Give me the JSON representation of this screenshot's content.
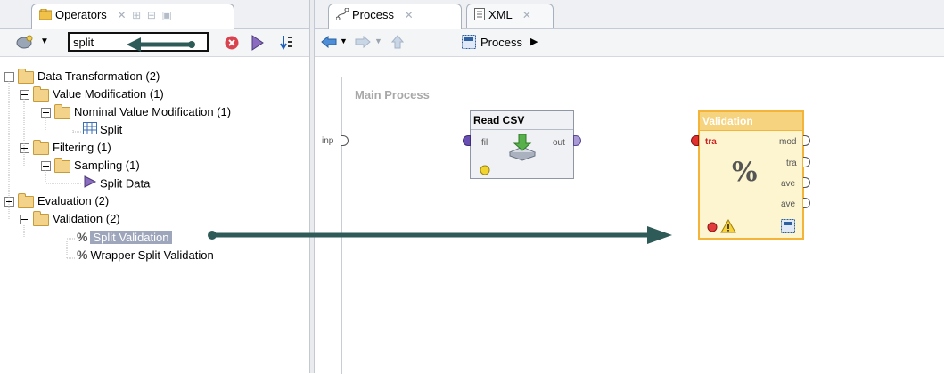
{
  "left_panel": {
    "tab_label": "Operators",
    "search_value": "split",
    "tree": [
      {
        "label": "Data Transformation (2)"
      },
      {
        "label": "Value Modification (1)"
      },
      {
        "label": "Nominal Value Modification (1)"
      },
      {
        "label": "Split"
      },
      {
        "label": "Filtering (1)"
      },
      {
        "label": "Sampling (1)"
      },
      {
        "label": "Split Data"
      },
      {
        "label": "Evaluation (2)"
      },
      {
        "label": "Validation (2)"
      },
      {
        "label": "Split Validation"
      },
      {
        "label": "Wrapper Split Validation"
      }
    ]
  },
  "right_panel": {
    "tabs": [
      {
        "label": "Process"
      },
      {
        "label": "XML"
      }
    ],
    "breadcrumb": "Process",
    "canvas_title": "Main Process",
    "input_port": "inp",
    "read_csv": {
      "title": "Read CSV",
      "in_port": "fil",
      "out_port": "out"
    },
    "validation": {
      "title": "Validation",
      "in_port": "tra",
      "out_ports": [
        "mod",
        "tra",
        "ave",
        "ave"
      ]
    }
  },
  "colors": {
    "accent_arrow": "#2e5a57",
    "validation_border": "#f4b43a",
    "validation_fill": "#fdf5cf",
    "selection_bg": "#9ea6bc"
  }
}
